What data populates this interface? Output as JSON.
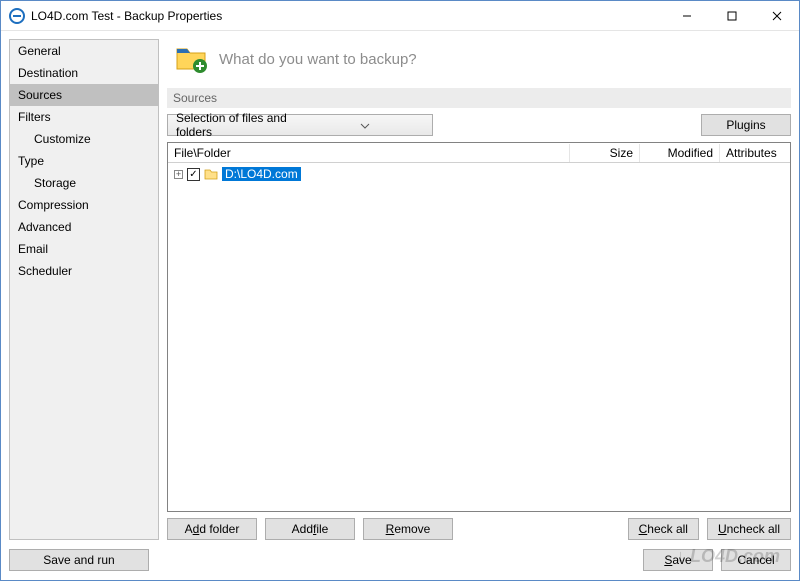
{
  "window": {
    "title": "LO4D.com Test - Backup Properties"
  },
  "sidebar": {
    "items": [
      {
        "label": "General",
        "indent": false,
        "selected": false
      },
      {
        "label": "Destination",
        "indent": false,
        "selected": false
      },
      {
        "label": "Sources",
        "indent": false,
        "selected": true
      },
      {
        "label": "Filters",
        "indent": false,
        "selected": false
      },
      {
        "label": "Customize",
        "indent": true,
        "selected": false
      },
      {
        "label": "Type",
        "indent": false,
        "selected": false
      },
      {
        "label": "Storage",
        "indent": true,
        "selected": false
      },
      {
        "label": "Compression",
        "indent": false,
        "selected": false
      },
      {
        "label": "Advanced",
        "indent": false,
        "selected": false
      },
      {
        "label": "Email",
        "indent": false,
        "selected": false
      },
      {
        "label": "Scheduler",
        "indent": false,
        "selected": false
      }
    ]
  },
  "main": {
    "prompt": "What do you want to backup?",
    "section_label": "Sources",
    "dropdown": {
      "value": "Selection of files and folders"
    },
    "plugins_button": "Plugins",
    "columns": {
      "c0": "File\\Folder",
      "c1": "Size",
      "c2": "Modified",
      "c3": "Attributes"
    },
    "rows": [
      {
        "expanded": false,
        "checked": true,
        "label": "D:\\LO4D.com"
      }
    ],
    "buttons": {
      "add_folder": {
        "pre": "A",
        "ul": "d",
        "post": "d folder"
      },
      "add_file": {
        "pre": "Add ",
        "ul": "f",
        "post": "ile"
      },
      "remove": {
        "pre": "",
        "ul": "R",
        "post": "emove"
      },
      "check_all": {
        "pre": "",
        "ul": "C",
        "post": "heck all"
      },
      "uncheck_all": {
        "pre": "",
        "ul": "U",
        "post": "ncheck all"
      }
    }
  },
  "footer": {
    "save_and_run": "Save and run",
    "save": {
      "pre": "",
      "ul": "S",
      "post": "ave"
    },
    "cancel": "Cancel"
  },
  "watermark": "↓ LO4D.com"
}
